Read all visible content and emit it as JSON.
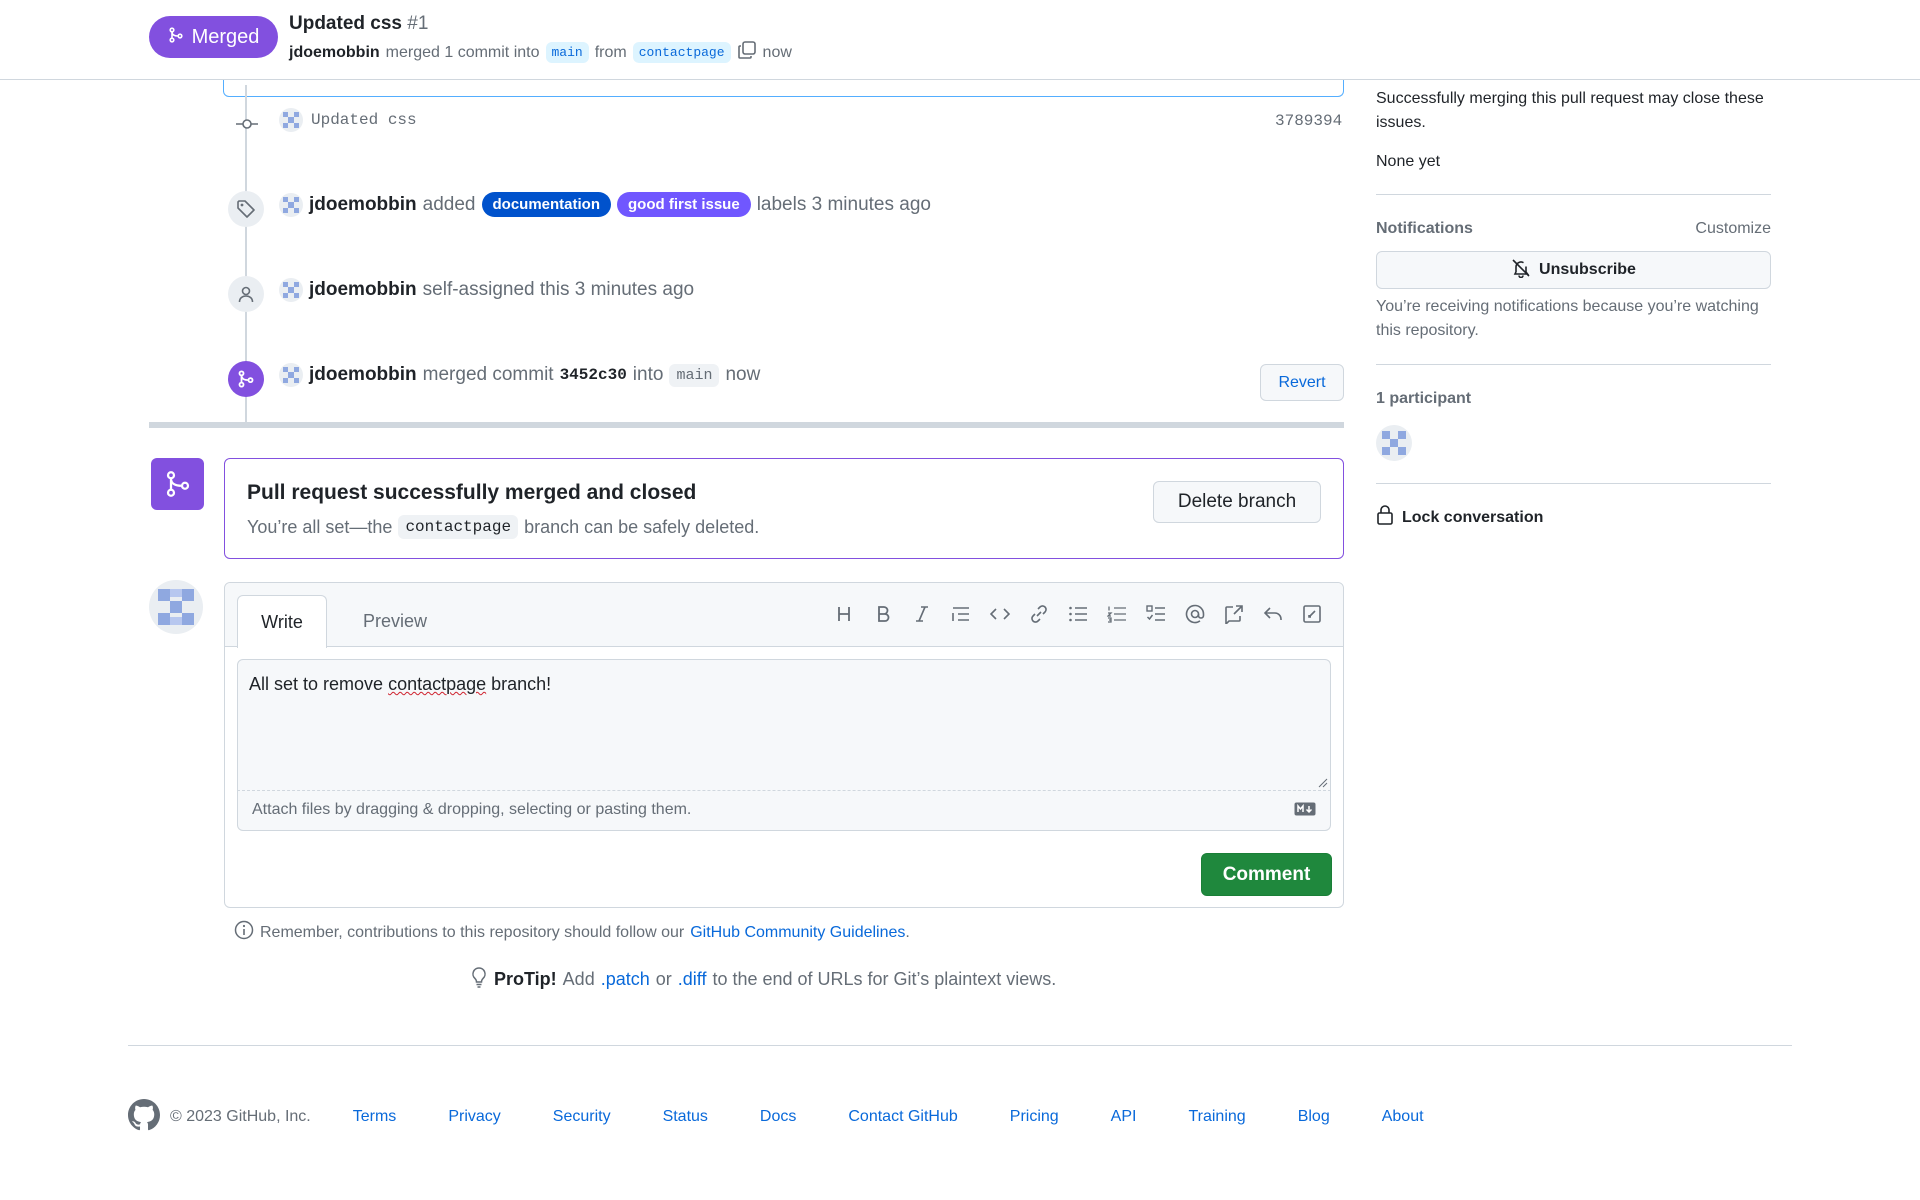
{
  "header": {
    "status_badge": "Merged",
    "title": "Updated css",
    "number": "#1",
    "author": "jdoemobbin",
    "meta_text": "merged 1 commit into",
    "base_branch": "main",
    "from_text": "from",
    "head_branch": "contactpage",
    "time": "now"
  },
  "timeline": {
    "commit": {
      "message": "Updated css",
      "sha": "3789394"
    },
    "labels_event": {
      "actor": "jdoemobbin",
      "action": "added",
      "labels": [
        {
          "name": "documentation",
          "color": "#0052cc"
        },
        {
          "name": "good first issue",
          "color": "#7057ff"
        }
      ],
      "suffix": "labels 3 minutes ago"
    },
    "assign_event": {
      "actor": "jdoemobbin",
      "text": "self-assigned this 3 minutes ago"
    },
    "merge_event": {
      "actor": "jdoemobbin",
      "text1": "merged commit",
      "commit": "3452c30",
      "text2": "into",
      "branch": "main",
      "time": "now",
      "revert_label": "Revert"
    }
  },
  "merge_box": {
    "title": "Pull request successfully merged and closed",
    "sub_prefix": "You’re all set—the",
    "branch": "contactpage",
    "sub_suffix": "branch can be safely deleted.",
    "delete_label": "Delete branch"
  },
  "comment_form": {
    "tab_write": "Write",
    "tab_preview": "Preview",
    "text_before": "All set to remove ",
    "text_misspelled": "contactpage",
    "text_after": " branch!",
    "attach_text": "Attach files by dragging & dropping, selecting or pasting them.",
    "submit_label": "Comment"
  },
  "guidelines": {
    "text": "Remember, contributions to this repository should follow our",
    "link": "GitHub Community Guidelines",
    "end": "."
  },
  "protip": {
    "label": "ProTip!",
    "text1": "Add",
    "patch": ".patch",
    "text2": "or",
    "diff": ".diff",
    "text3": "to the end of URLs for Git’s plaintext views."
  },
  "sidebar": {
    "issues_text": "Successfully merging this pull request may close these issues.",
    "issues_none": "None yet",
    "notifications_title": "Notifications",
    "customize": "Customize",
    "unsubscribe": "Unsubscribe",
    "notifications_reason": "You’re receiving notifications because you’re watching this repository.",
    "participants": "1 participant",
    "lock": "Lock conversation"
  },
  "footer": {
    "copyright": "© 2023 GitHub, Inc.",
    "links": [
      "Terms",
      "Privacy",
      "Security",
      "Status",
      "Docs",
      "Contact GitHub",
      "Pricing",
      "API",
      "Training",
      "Blog",
      "About"
    ]
  },
  "colors": {
    "merged": "#8250df",
    "link": "#0969da",
    "primary_button": "#1f883d"
  }
}
